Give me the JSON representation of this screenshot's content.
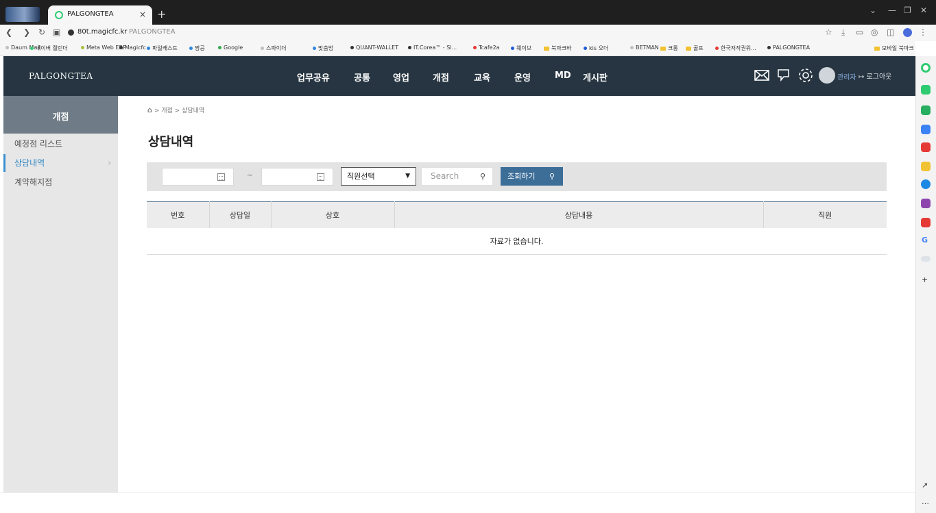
{
  "browser": {
    "tab_title": "PALGONGTEA",
    "tab_close": "×",
    "new_tab": "+",
    "address_url": "80t.magicfc.kr",
    "address_page_title": "PALGONGTEA",
    "bookmarks": [
      {
        "label": "Daum Mail",
        "color": "#bfbfbf"
      },
      {
        "label": "네이버 캘린더",
        "color": "#2ecc71"
      },
      {
        "label": "Meta Web ERP",
        "color": "#a6c23a"
      },
      {
        "label": "Magicfc",
        "color": "#333333"
      },
      {
        "label": "파일캐스트",
        "color": "#2e86de"
      },
      {
        "label": "짱공",
        "color": "#2e86de"
      },
      {
        "label": "Google",
        "color": "#34a853"
      },
      {
        "label": "스파이더",
        "color": "#bfbfbf"
      },
      {
        "label": "맞춤법",
        "color": "#2e86de"
      },
      {
        "label": "QUANT-WALLET",
        "color": "#333333"
      },
      {
        "label": "IT.Corea™ - Sl...",
        "color": "#333333"
      },
      {
        "label": "Tcafe2a",
        "color": "#e53935"
      },
      {
        "label": "웨이브",
        "color": "#1e5ad8"
      },
      {
        "label": "북마크바",
        "color": "#f1c232"
      },
      {
        "label": "kis 오더",
        "color": "#1e5ad8"
      },
      {
        "label": "BETMAN",
        "color": "#bfbfbf"
      },
      {
        "label": "크롱",
        "color": "#f1c232"
      },
      {
        "label": "골프",
        "color": "#f1c232"
      },
      {
        "label": "한국저작권위...",
        "color": "#e53935"
      },
      {
        "label": "PALGONGTEA",
        "color": "#333333"
      }
    ],
    "mobile_bookmarks": "모바일 북마크"
  },
  "header": {
    "logo": "PALGONGTEA",
    "nav": [
      "업무공유",
      "공통",
      "영업",
      "개점",
      "교육",
      "운영",
      "MD",
      "게시판"
    ],
    "user_label": "관리자",
    "logout_label": "로그아웃"
  },
  "sidebar": {
    "title": "개점",
    "items": [
      {
        "label": "예정점 리스트",
        "active": false
      },
      {
        "label": "상담내역",
        "active": true
      },
      {
        "label": "계약해지점",
        "active": false
      }
    ]
  },
  "breadcrumb": {
    "home_icon": "home-icon",
    "path": "> 개점 > 상담내역"
  },
  "page": {
    "title": "상담내역"
  },
  "filters": {
    "date_from": "",
    "date_to": "",
    "range_separator": "~",
    "staff_select": "직원선택",
    "search_placeholder": "Search",
    "search_button": "조회하기"
  },
  "table": {
    "columns": [
      "번호",
      "상담일",
      "상호",
      "상담내용",
      "직원"
    ],
    "empty_message": "자료가 없습니다."
  },
  "colors": {
    "header_bg": "#263541",
    "sidebar_title_bg": "#6f7b86",
    "accent": "#3c6e98",
    "active_link": "#2e86c1"
  }
}
